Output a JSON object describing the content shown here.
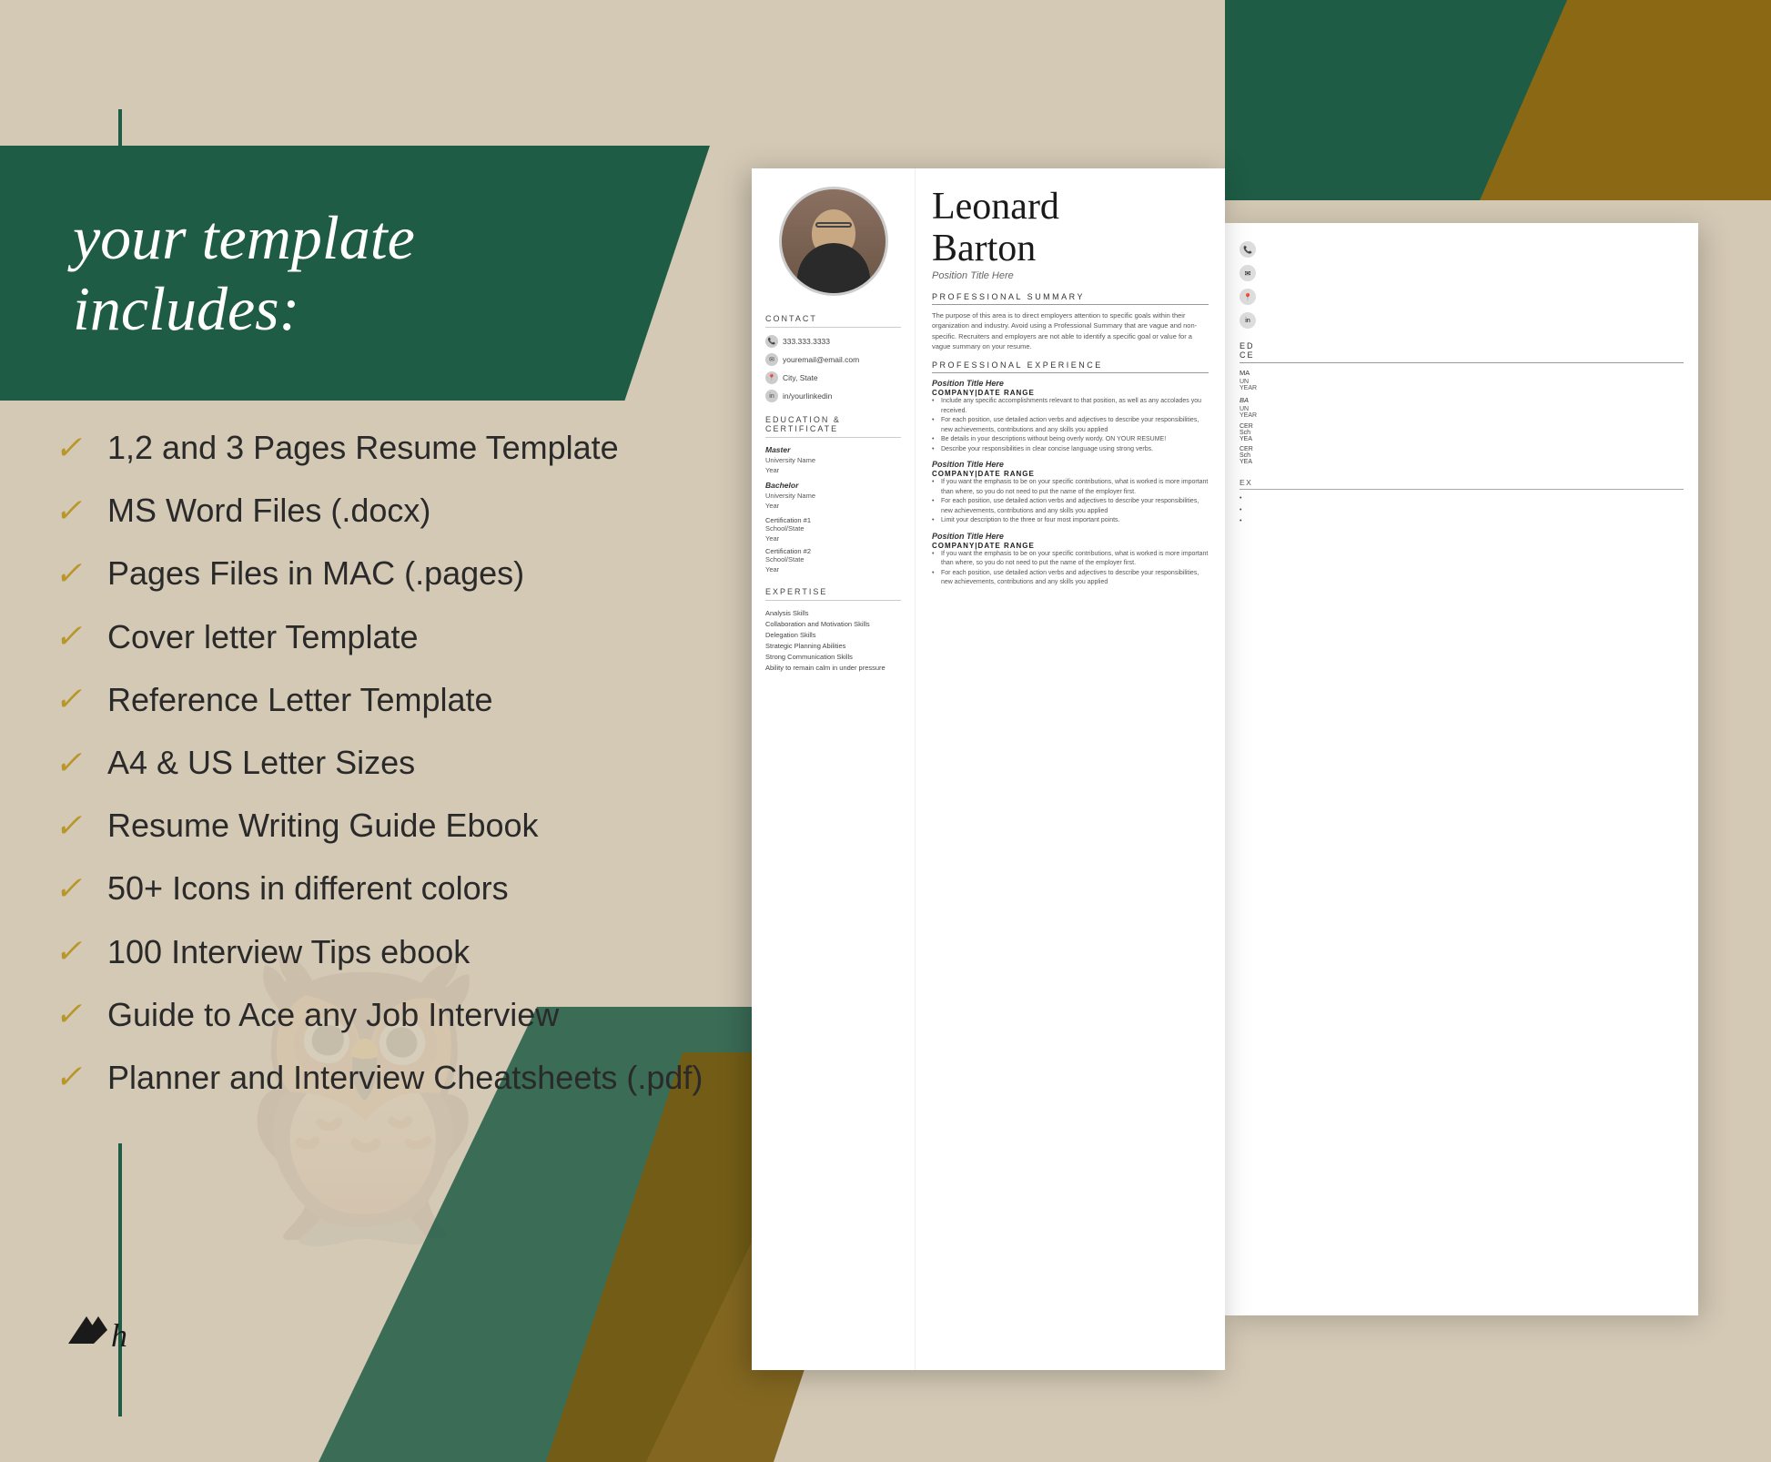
{
  "page": {
    "bg_color": "#d4c9b5"
  },
  "banner": {
    "line1": "your template",
    "line2": "includes:"
  },
  "checklist": {
    "items": [
      "1,2 and 3 Pages Resume Template",
      "MS Word Files (.docx)",
      "Pages Files in MAC (.pages)",
      "Cover letter Template",
      "Reference Letter Template",
      "A4 & US Letter Sizes",
      "Resume Writing Guide Ebook",
      "50+ Icons in different colors",
      "100 Interview Tips ebook",
      "Guide to Ace any Job Interview",
      "Planner and Interview Cheatsheets (.pdf)"
    ]
  },
  "resume": {
    "name_line1": "Leonard",
    "name_line2": "Barton",
    "position": "Position Title Here",
    "contact_section": "Contact",
    "phone": "333.333.3333",
    "email": "youremail@email.com",
    "location": "City, State",
    "linkedin": "in/yourlinkedin",
    "education_section": "Education & Certificate",
    "degree1_label": "Master",
    "degree1_school": "University Name",
    "degree1_year": "Year",
    "degree2_label": "Bachelor",
    "degree2_school": "University Name",
    "degree2_year": "Year",
    "cert1_label": "Certification #1",
    "cert1_school": "School/State",
    "cert1_year": "Year",
    "cert2_label": "Certification #2",
    "cert2_school": "School/State",
    "cert2_year": "Year",
    "expertise_section": "Expertise",
    "expertise_items": [
      "Analysis Skills",
      "Collaboration and Motivation Skills",
      "Delegation Skills",
      "Strategic Planning Abilities",
      "Strong Communication Skills",
      "Ability to remain calm in under pressure"
    ],
    "summary_section": "Professional Summary",
    "summary_text": "The purpose of this area is to direct employers attention to specific goals within their organization and industry. Avoid using a Professional Summary that are vague and non-specific. Recruiters and employers are not able to identify a specific goal or value for a vague summary on your resume.",
    "experience_section": "Professional Experience",
    "exp1_position": "Position Title Here",
    "exp1_company": "Company|Date Range",
    "exp1_bullets": [
      "Include any specific accomplishments relevant to that position, as well as any accolades you received.",
      "For each position, use detailed action verbs and adjectives to describe your responsibilities, new achievements, contributions and any skills you applied",
      "Be details in your descriptions without being overly wordy. ON YOUR RESUME!",
      "Describe your responsibilities in clear concise language using strong verbs."
    ],
    "exp2_position": "Position Title Here",
    "exp2_company": "Company|Date Range",
    "exp2_bullets": [
      "If you want the emphasis to be on your specific contributions, what is worked is more important than where, so you do not need to put the name of the employer first.",
      "For each position, use detailed action verbs and adjectives to describe your responsibilities, new achievements, contributions and any skills you applied",
      "Limit your description to the three or four most important points."
    ],
    "exp3_position": "Position Title Here",
    "exp3_company": "Company|Date Range",
    "exp3_bullets": [
      "If you want the emphasis to be on your specific contributions, what is worked is more important than where, so you do not need to put the name of the employer first.",
      "For each position, use detailed action verbs and adjectives to describe your responsibilities, new achievements, contributions and any skills you applied"
    ]
  }
}
